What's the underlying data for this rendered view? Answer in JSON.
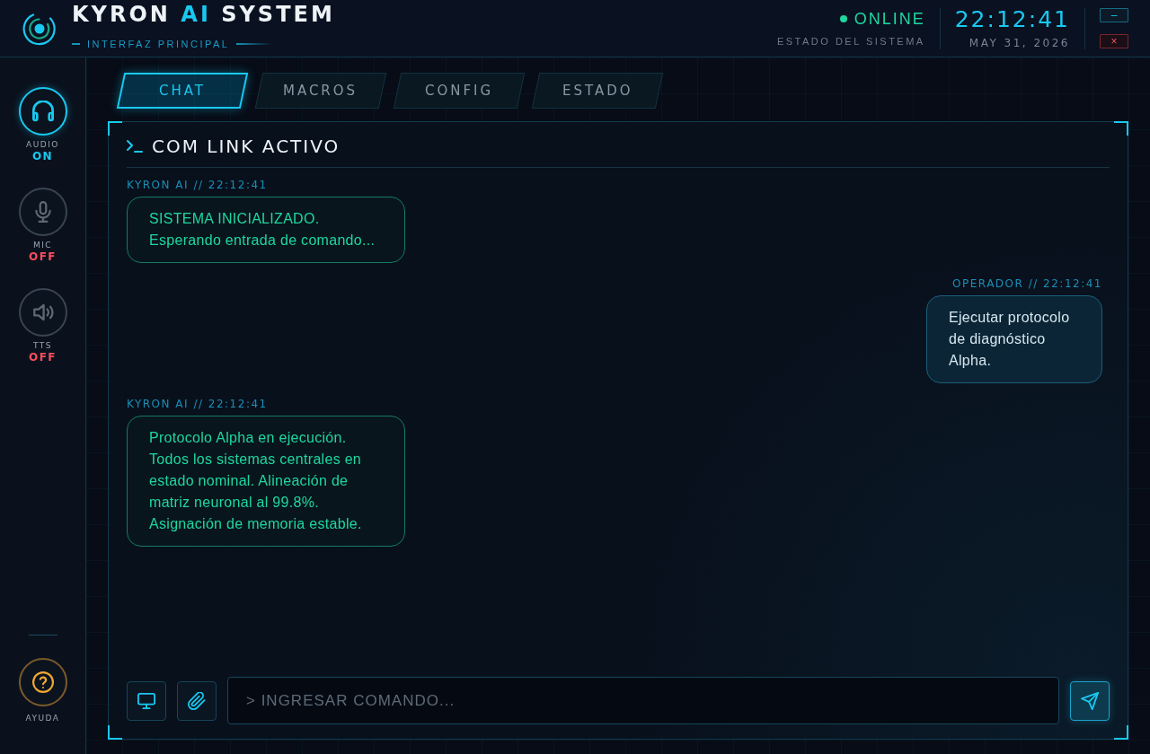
{
  "header": {
    "title": {
      "lead": "KYRON",
      "accent": "AI",
      "tail": "SYSTEM"
    },
    "subtitle": "INTERFAZ PRINCIPAL",
    "status": {
      "label": "ONLINE",
      "caption": "ESTADO DEL SISTEMA",
      "online": true
    },
    "clock": {
      "time": "22:12:41",
      "date": "MAY 31, 2026"
    },
    "window_buttons": [
      {
        "kind": "minimize",
        "label": "–"
      },
      {
        "kind": "close",
        "label": "×"
      }
    ]
  },
  "sidebar": {
    "toggles": [
      {
        "kind": "audio",
        "label": "AUDIO",
        "state": "ON",
        "on": true
      },
      {
        "kind": "mic",
        "label": "MIC",
        "state": "OFF",
        "on": false
      },
      {
        "kind": "tts",
        "label": "TTS",
        "state": "OFF",
        "on": false
      }
    ],
    "help": {
      "label": "AYUDA"
    }
  },
  "tabs": [
    {
      "label": "CHAT",
      "selected": true
    },
    {
      "label": "MACROS",
      "selected": false
    },
    {
      "label": "CONFIG",
      "selected": false
    },
    {
      "label": "ESTADO",
      "selected": false
    }
  ],
  "chat": {
    "title": "COM LINK ACTIVO",
    "messages": [
      {
        "kind": "ai",
        "meta": "KYRON AI // 22:12:41",
        "text": "SISTEMA INICIALIZADO. Esperando entrada de comando..."
      },
      {
        "kind": "operator",
        "meta": "OPERADOR // 22:12:41",
        "text": "Ejecutar protocolo de diagnóstico Alpha."
      },
      {
        "kind": "ai",
        "meta": "KYRON AI // 22:12:41",
        "text": "Protocolo Alpha en ejecución. Todos los sistemas centrales en estado nominal. Alineación de matriz neuronal al 99.8%. Asignación de memoria estable."
      }
    ],
    "composer": {
      "placeholder": "> INGRESAR COMANDO..."
    }
  }
}
